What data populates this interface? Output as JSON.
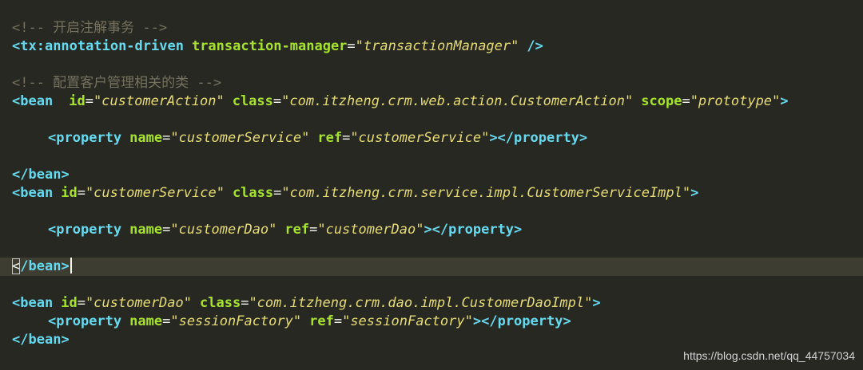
{
  "editor": {
    "theme": {
      "background": "#272822",
      "current_line": "#3e3d32",
      "comment": "#75715e",
      "tag": "#66d9ef",
      "attribute": "#a6e22e",
      "string": "#e6db74",
      "punctuation": "#f8f8f2"
    },
    "lines": {
      "l1": {
        "comment": "<!-- 开启注解事务 -->"
      },
      "l2": {
        "open": "<",
        "tag": "tx:annotation-driven",
        "a1": "transaction-manager",
        "v1": "\"transactionManager\"",
        "close": "/>"
      },
      "l4": {
        "comment": "<!-- 配置客户管理相关的类 -->"
      },
      "l5": {
        "open": "<",
        "tag": "bean",
        "a1": "id",
        "v1": "\"customerAction\"",
        "a2": "class",
        "v2": "\"com.itzheng.crm.web.action.CustomerAction\"",
        "a3": "scope",
        "v3": "\"prototype\"",
        "close": ">"
      },
      "l7": {
        "open": "<",
        "tag": "property",
        "a1": "name",
        "v1": "\"customerService\"",
        "a2": "ref",
        "v2": "\"customerService\"",
        "mid": "></",
        "tag_end": "property",
        "close": ">"
      },
      "l9": {
        "open": "</",
        "tag": "bean",
        "close": ">"
      },
      "l10": {
        "open": "<",
        "tag": "bean",
        "a1": "id",
        "v1": "\"customerService\"",
        "a2": "class",
        "v2": "\"com.itzheng.crm.service.impl.CustomerServiceImpl\"",
        "close": ">"
      },
      "l12": {
        "open": "<",
        "tag": "property",
        "a1": "name",
        "v1": "\"customerDao\"",
        "a2": "ref",
        "v2": "\"customerDao\"",
        "mid": "></",
        "tag_end": "property",
        "close": ">"
      },
      "l14": {
        "open_lt": "<",
        "open_slash": "/",
        "tag": "bean",
        "close": ">"
      },
      "l16": {
        "open": "<",
        "tag": "bean",
        "a1": "id",
        "v1": "\"customerDao\"",
        "a2": "class",
        "v2": "\"com.itzheng.crm.dao.impl.CustomerDaoImpl\"",
        "close": ">"
      },
      "l17": {
        "open": "<",
        "tag": "property",
        "a1": "name",
        "v1": "\"sessionFactory\"",
        "a2": "ref",
        "v2": "\"sessionFactory\"",
        "mid": "></",
        "tag_end": "property",
        "close": ">"
      },
      "l18": {
        "open": "</",
        "tag": "bean",
        "close": ">"
      }
    },
    "eq": "="
  },
  "watermark": "https://blog.csdn.net/qq_44757034"
}
